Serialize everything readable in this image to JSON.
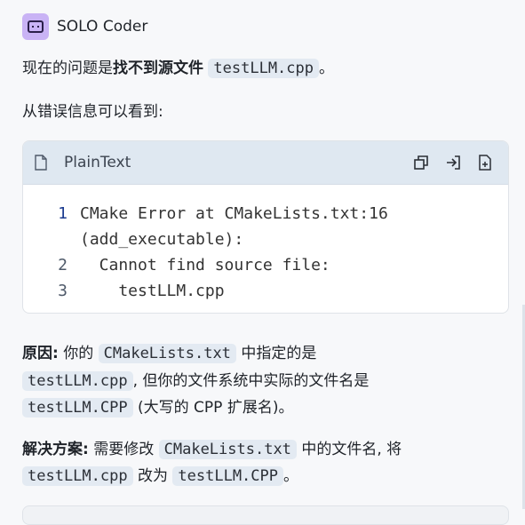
{
  "header": {
    "app_name": "SOLO Coder",
    "avatar_icon": "robot-face-icon",
    "avatar_color": "#c9b3f5"
  },
  "para1": {
    "prefix": "现在的问题是",
    "bold": "找不到源文件",
    "code": "testLLM.cpp",
    "suffix": "。"
  },
  "para2": {
    "text": "从错误信息可以看到:"
  },
  "codeblock": {
    "language": "PlainText",
    "lines": [
      {
        "number": "1",
        "text": "CMake Error at CMakeLists.txt:16"
      },
      {
        "number": "",
        "text": "(add_executable):"
      },
      {
        "number": "2",
        "text": "  Cannot find source file:"
      },
      {
        "number": "3",
        "text": "    testLLM.cpp"
      }
    ]
  },
  "reason": {
    "label": "原因:",
    "t1": "你的",
    "c1": "CMakeLists.txt",
    "t2": "中指定的是",
    "c2": "testLLM.cpp",
    "t3": ", 但你的文件系统中实际的文件名是",
    "c3": "testLLM.CPP",
    "t4": "(大写的 CPP 扩展名)。"
  },
  "solution": {
    "label": "解决方案:",
    "t1": "需要修改",
    "c1": "CMakeLists.txt",
    "t2": "中的文件名, 将",
    "c2": "testLLM.cpp",
    "t3": "改为",
    "c3": "testLLM.CPP",
    "t4": "。"
  }
}
